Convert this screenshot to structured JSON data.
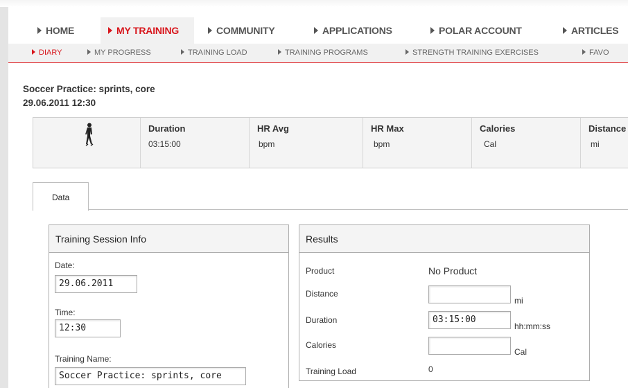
{
  "main_nav": [
    {
      "label": "HOME",
      "active": false
    },
    {
      "label": "MY TRAINING",
      "active": true
    },
    {
      "label": "COMMUNITY",
      "active": false
    },
    {
      "label": "APPLICATIONS",
      "active": false
    },
    {
      "label": "POLAR ACCOUNT",
      "active": false
    },
    {
      "label": "ARTICLES",
      "active": false
    }
  ],
  "sub_nav": [
    {
      "label": "DIARY",
      "active": true
    },
    {
      "label": "MY PROGRESS",
      "active": false
    },
    {
      "label": "TRAINING LOAD",
      "active": false
    },
    {
      "label": "TRAINING PROGRAMS",
      "active": false
    },
    {
      "label": "STRENGTH TRAINING EXERCISES",
      "active": false
    },
    {
      "label": "FAVO",
      "active": false
    }
  ],
  "session": {
    "title": "Soccer Practice: sprints, core",
    "datetime": "29.06.2011 12:30",
    "sport_icon": "walking-person-icon"
  },
  "summary": [
    {
      "label": "Duration",
      "value": "03:15:00"
    },
    {
      "label": "HR Avg",
      "value": "bpm"
    },
    {
      "label": "HR Max",
      "value": "bpm"
    },
    {
      "label": "Calories",
      "value": "Cal"
    },
    {
      "label": "Distance",
      "value": "mi"
    }
  ],
  "tabs": [
    {
      "label": "Data",
      "active": true
    }
  ],
  "info_panel": {
    "title": "Training Session Info",
    "date_label": "Date:",
    "date_value": "29.06.2011",
    "time_label": "Time:",
    "time_value": "12:30",
    "name_label": "Training Name:",
    "name_value": "Soccer Practice: sprints, core"
  },
  "results_panel": {
    "title": "Results",
    "product_label": "Product",
    "product_value": "No Product",
    "distance_label": "Distance",
    "distance_value": "",
    "distance_unit": "mi",
    "duration_label": "Duration",
    "duration_value": "03:15:00",
    "duration_unit": "hh:mm:ss",
    "calories_label": "Calories",
    "calories_value": "",
    "calories_unit": "Cal",
    "load_label": "Training Load",
    "load_value": "0"
  },
  "colors": {
    "accent": "#d8161c",
    "nav_bg": "#f1f1f1",
    "panel_head": "#f4f4f4"
  }
}
